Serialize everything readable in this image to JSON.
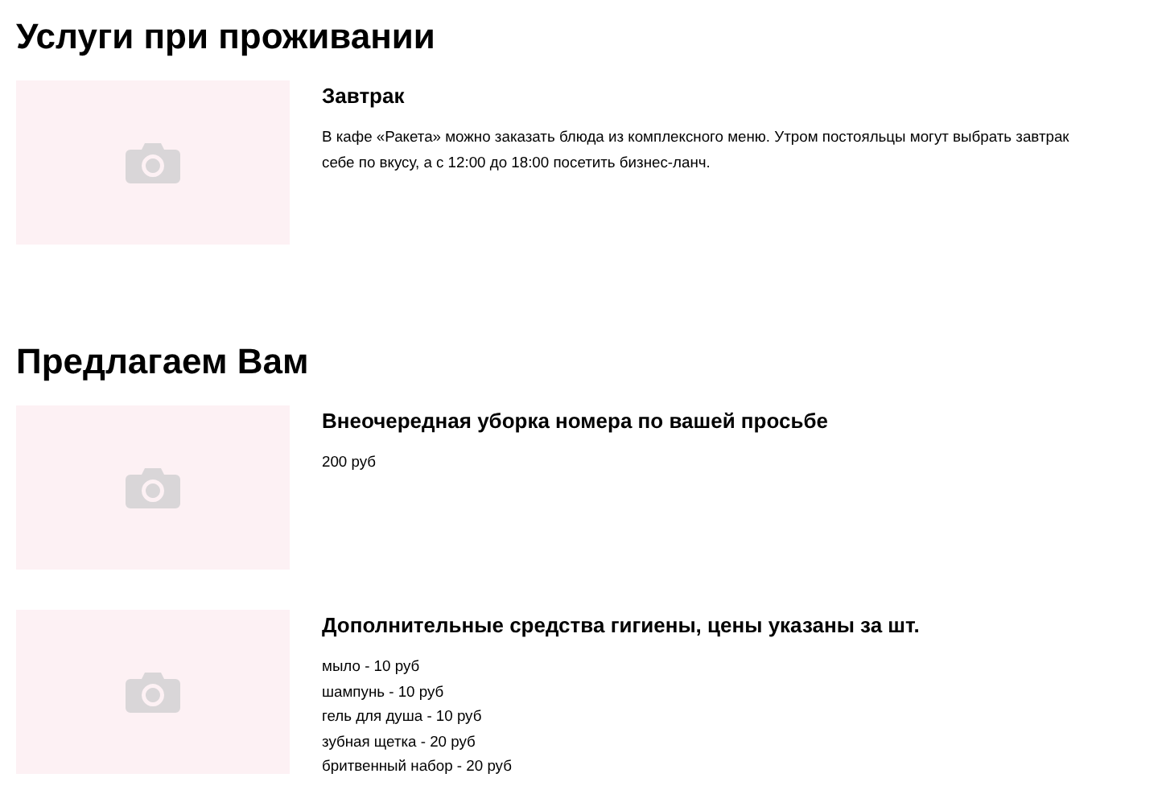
{
  "sections": [
    {
      "title": "Услуги при проживании",
      "items": [
        {
          "image": {
            "kind": "picture"
          },
          "title": "Завтрак",
          "lines": [
            "В кафе «Ракета» можно заказать блюда из комплексного меню. Утром постояльцы могут выбрать завтрак",
            "себе по вкусу, а с 12:00 до 18:00 посетить бизнес-ланч."
          ]
        }
      ]
    },
    {
      "title": "Предлагаем Вам",
      "items": [
        {
          "image": {
            "kind": "picture"
          },
          "title": "Внеочередная уборка номера по вашей просьбе",
          "lines": [
            "200 руб"
          ]
        },
        {
          "image": {
            "kind": "picture"
          },
          "title": "Дополнительные средства гигиены, цены указаны за шт.",
          "lines": [
            "мыло - 10 руб",
            "шампунь - 10 руб",
            "гель для душа - 10 руб",
            "зубная щетка - 20 руб",
            "бритвенный набор - 20 руб"
          ]
        }
      ]
    }
  ]
}
